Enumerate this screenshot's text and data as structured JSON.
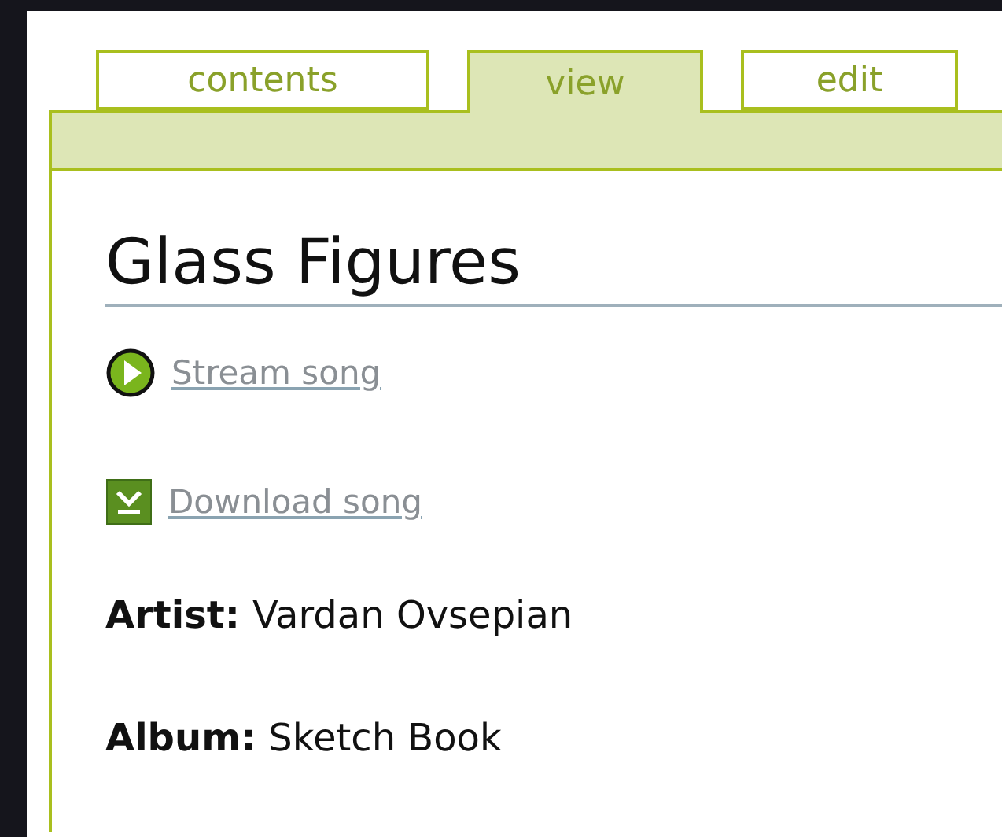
{
  "tabs": [
    {
      "label": "contents",
      "selected": false
    },
    {
      "label": "view",
      "selected": true
    },
    {
      "label": "edit",
      "selected": false
    }
  ],
  "title": "Glass Figures",
  "links": [
    {
      "kind": "stream",
      "label": "Stream song"
    },
    {
      "kind": "download",
      "label": "Download song"
    }
  ],
  "fields": [
    {
      "label": "Artist:",
      "value": "Vardan Ovsepian"
    },
    {
      "label": "Album:",
      "value": "Sketch Book"
    }
  ]
}
